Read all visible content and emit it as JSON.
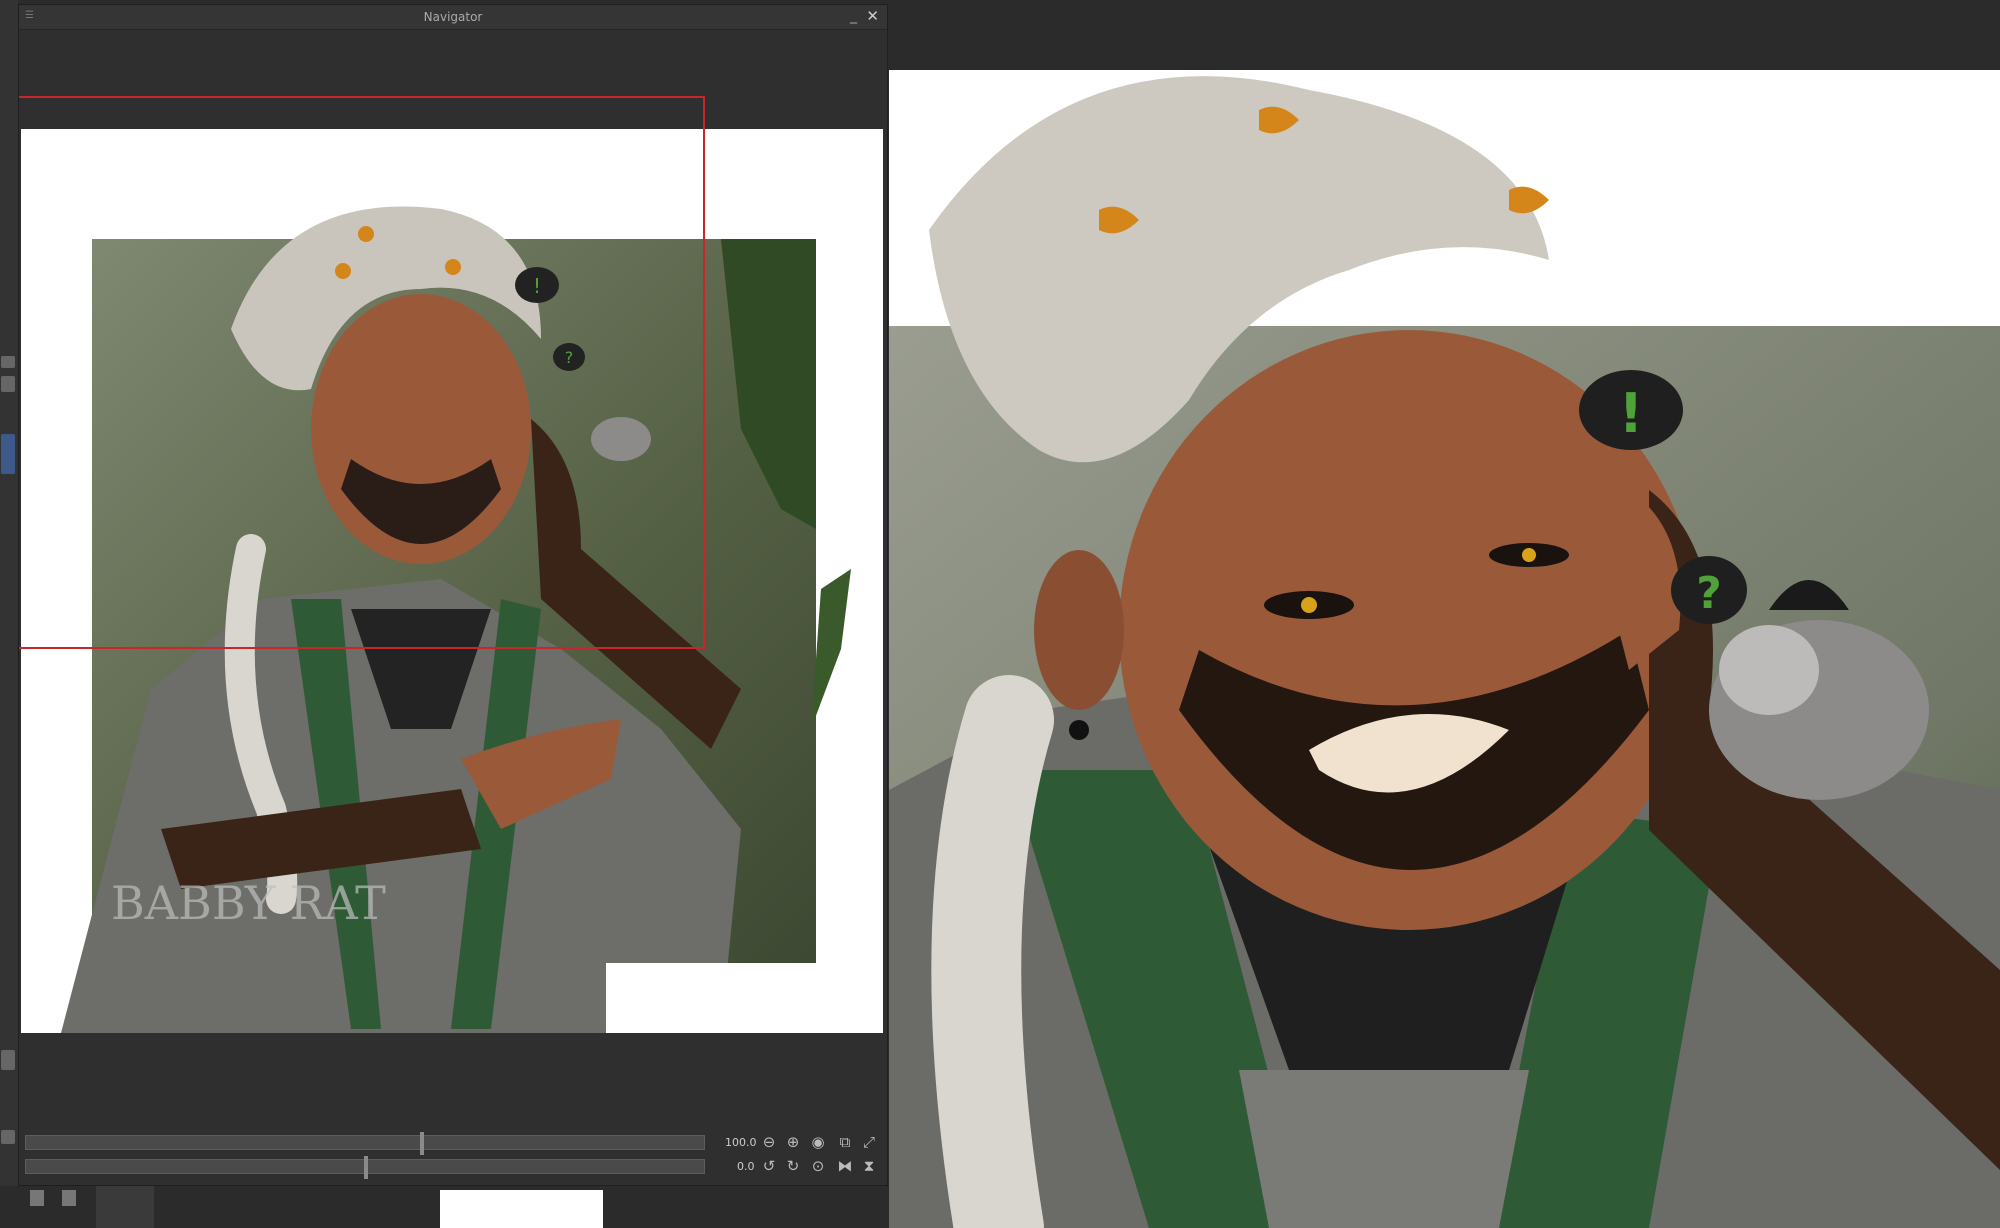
{
  "navigator": {
    "title": "Navigator",
    "zoom_value": "100.0",
    "rotation_value": "0.0"
  },
  "artwork": {
    "signature": "BABBY RAT",
    "speech_bubble_1": "!",
    "speech_bubble_2": "?"
  },
  "colors": {
    "view_rect": "#c8262a",
    "forest_bg": "#5a6448",
    "robe_green": "#2f5a36",
    "skin": "#9a5a3a",
    "hair": "#c9c5bd"
  },
  "icons": [
    "menu-icon",
    "minimize-icon",
    "close-icon",
    "zoom-out-icon",
    "zoom-in-icon",
    "fit-icon",
    "actual-size-icon",
    "fit-window-icon",
    "rotate-left-icon",
    "rotate-right-icon",
    "reset-rotation-icon",
    "flip-horizontal-icon",
    "flip-vertical-icon"
  ]
}
